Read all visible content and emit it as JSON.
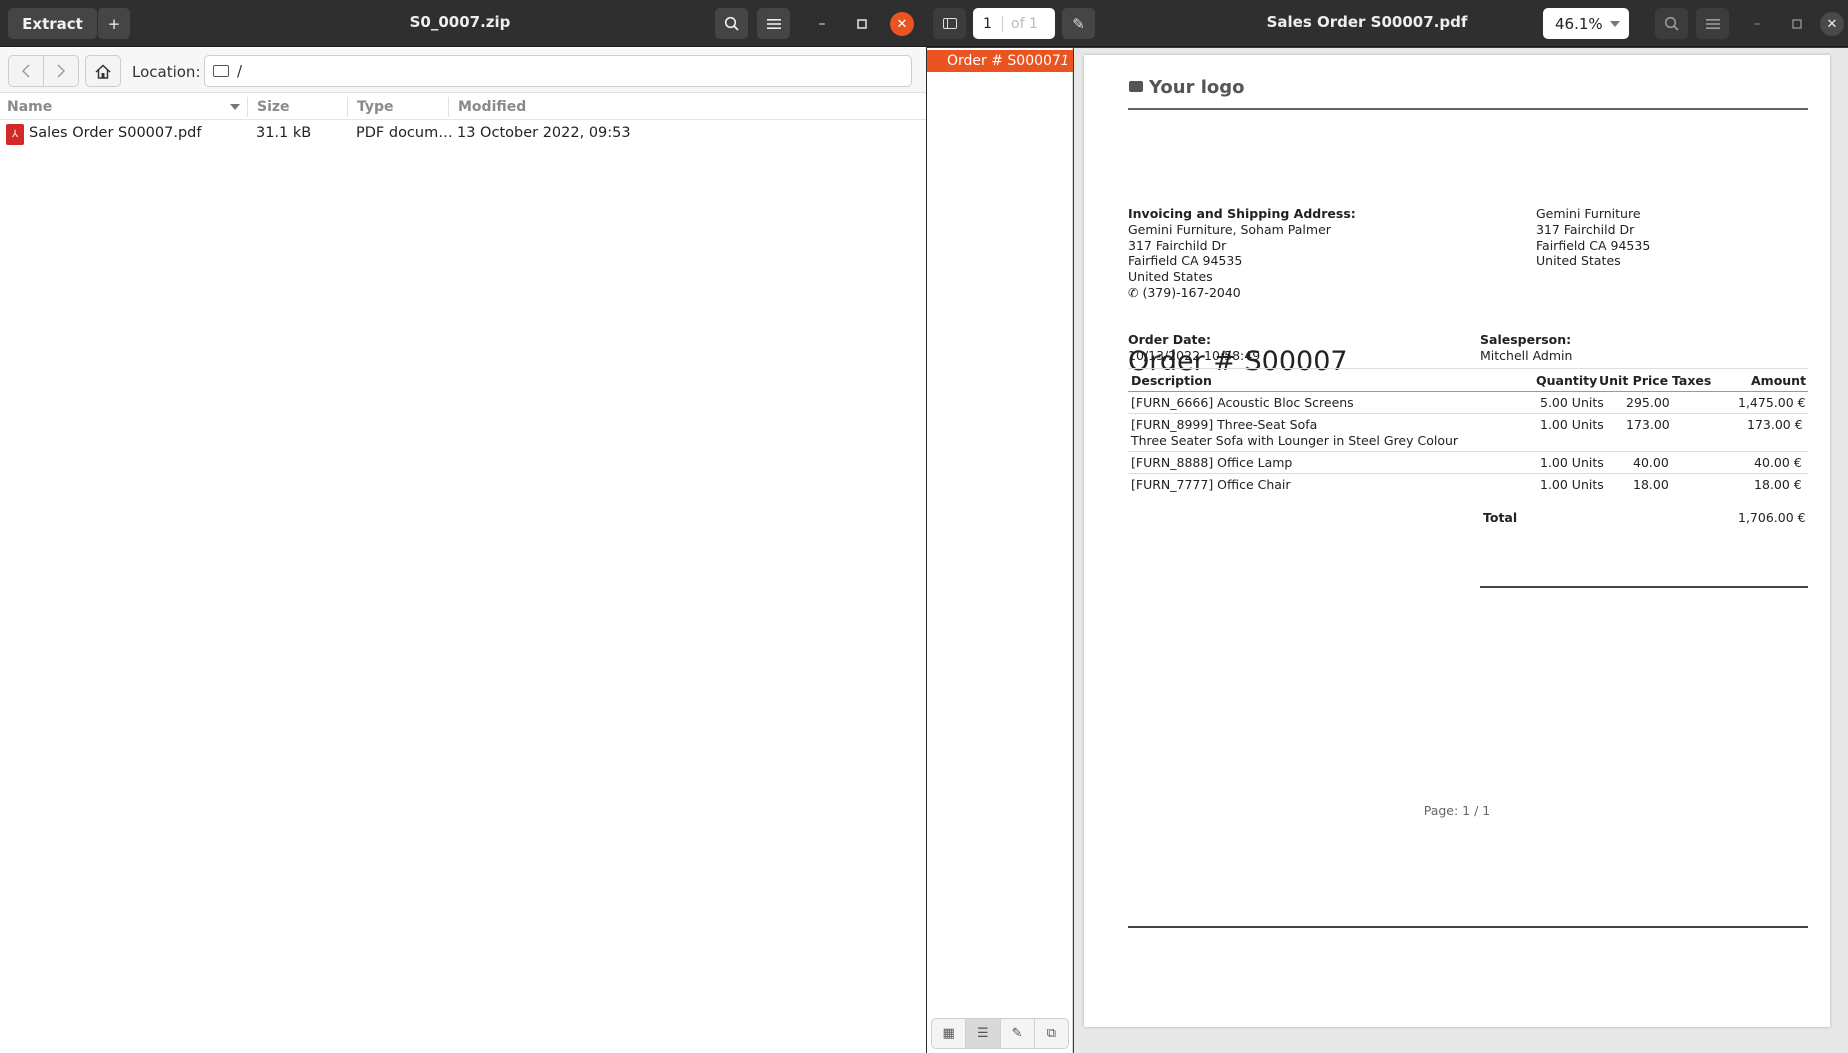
{
  "archive": {
    "extract_label": "Extract",
    "add_label": "+",
    "title": "S0_0007.zip",
    "location_label": "Location:",
    "location_value": "/",
    "columns": {
      "name": "Name",
      "size": "Size",
      "type": "Type",
      "modified": "Modified"
    },
    "files": [
      {
        "name": "Sales Order S00007.pdf",
        "size": "31.1 kB",
        "type": "PDF docum…",
        "modified": "13 October 2022, 09:53"
      }
    ]
  },
  "viewer": {
    "page_number": "1",
    "page_of": "of 1",
    "title": "Sales Order S00007.pdf",
    "zoom": "46.1%",
    "outline": [
      {
        "label": "Order # S00007",
        "page": "1"
      }
    ]
  },
  "document": {
    "logo_text": "Your logo",
    "address_heading": "Invoicing and Shipping Address:",
    "customer_lines": [
      "Gemini Furniture, Soham Palmer",
      "317 Fairchild Dr",
      "Fairfield CA 94535",
      "United States"
    ],
    "customer_phone": "(379)-167-2040",
    "company_lines": [
      "Gemini Furniture",
      "317 Fairchild Dr",
      "Fairfield CA 94535",
      "United States"
    ],
    "order_title": "Order # S00007",
    "order_date_label": "Order Date:",
    "order_date": "10/13/2022 10:58:49",
    "salesperson_label": "Salesperson:",
    "salesperson": "Mitchell Admin",
    "table_headers": {
      "description": "Description",
      "quantity": "Quantity",
      "unit_price": "Unit Price",
      "taxes": "Taxes",
      "amount": "Amount"
    },
    "lines": [
      {
        "description": "[FURN_6666] Acoustic Bloc Screens",
        "subdesc": "",
        "quantity": "5.00 Units",
        "unit_price": "295.00",
        "amount": "1,475.00 €"
      },
      {
        "description": "[FURN_8999] Three-Seat Sofa",
        "subdesc": "Three Seater Sofa with Lounger in Steel Grey Colour",
        "quantity": "1.00 Units",
        "unit_price": "173.00",
        "amount": "173.00 €"
      },
      {
        "description": "[FURN_8888] Office Lamp",
        "subdesc": "",
        "quantity": "1.00 Units",
        "unit_price": "40.00",
        "amount": "40.00 €"
      },
      {
        "description": "[FURN_7777] Office Chair",
        "subdesc": "",
        "quantity": "1.00 Units",
        "unit_price": "18.00",
        "amount": "18.00 €"
      }
    ],
    "total_label": "Total",
    "total_value": "1,706.00 €",
    "footer": "Page: 1 / 1"
  }
}
